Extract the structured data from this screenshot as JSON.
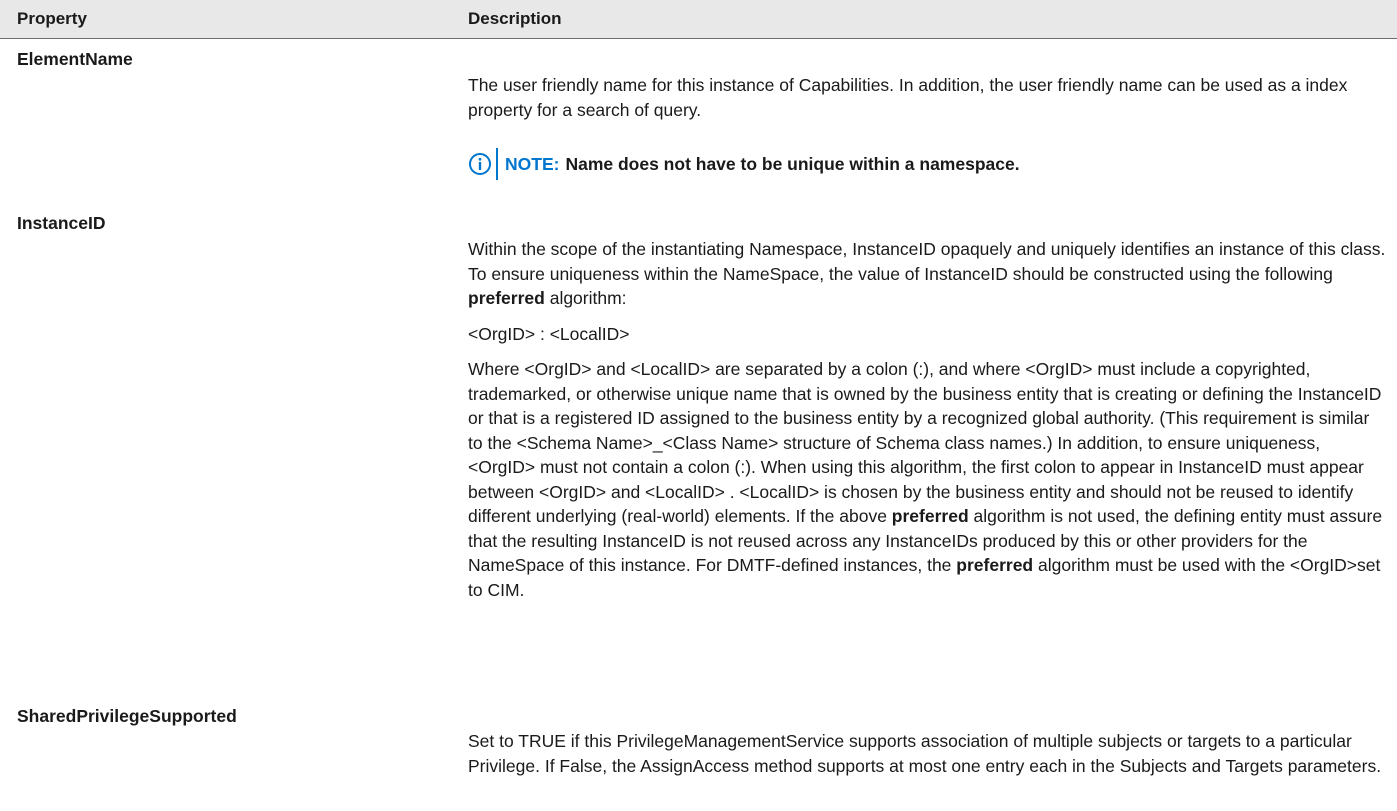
{
  "table": {
    "headers": {
      "property": "Property",
      "description": "Description"
    },
    "rows": [
      {
        "property": "ElementName",
        "description": "The user friendly name for this instance of Capabilities. In addition, the user friendly name can be used as a index property for a search of query.",
        "note": {
          "label": "NOTE:",
          "text": "Name does not have to be unique within a namespace."
        }
      },
      {
        "property": "InstanceID",
        "p1_before": "Within the scope of the instantiating Namespace, InstanceID opaquely and uniquely identifies an instance of this class. To ensure uniqueness within the NameSpace, the value of InstanceID should be constructed using the following ",
        "p1_bold": "preferred",
        "p1_after": " algorithm:",
        "p2": "<OrgID> : <LocalID>",
        "p3_part1": "Where <OrgID> and <LocalID> are separated by a colon (:), and where <OrgID> must include a copyrighted, trademarked, or otherwise unique name that is owned by the business entity that is creating or defining the InstanceID or that is a registered ID assigned to the business entity by a recognized global authority. (This requirement is similar to the <Schema Name>_<Class Name> structure of Schema class names.) In addition, to ensure uniqueness, <OrgID> must not contain a colon (:). When using this algorithm, the first colon to appear in InstanceID must appear between <OrgID> and <LocalID> . <LocalID> is chosen by the business entity and should not be reused to identify different underlying (real-world) elements. If the above ",
        "p3_bold1": "preferred",
        "p3_part2": " algorithm is not used, the defining entity must assure that the resulting InstanceID is not reused across any InstanceIDs produced by this or other providers for the NameSpace of this instance. For DMTF-defined instances, the ",
        "p3_bold2": "preferred",
        "p3_part3": " algorithm must be used with the <OrgID>set to CIM."
      },
      {
        "property": "SharedPrivilegeSupported",
        "description": "Set to TRUE if this PrivilegeManagementService supports association of multiple subjects or targets to a particular Privilege. If False, the AssignAccess method supports at most one entry each in the Subjects and Targets parameters."
      }
    ]
  },
  "icons": {
    "note": "info-circle-icon"
  },
  "colors": {
    "accent": "#0076ce",
    "header_bg": "#e8e8e8"
  }
}
